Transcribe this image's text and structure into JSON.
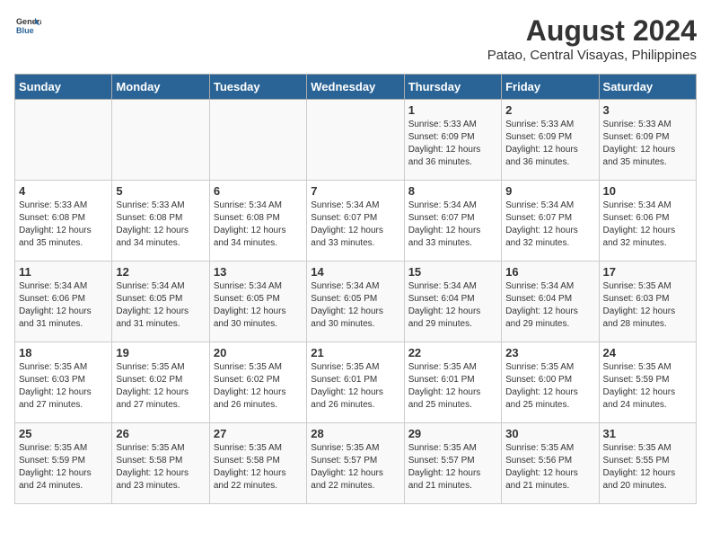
{
  "header": {
    "logo_general": "General",
    "logo_blue": "Blue",
    "title": "August 2024",
    "subtitle": "Patao, Central Visayas, Philippines"
  },
  "days_of_week": [
    "Sunday",
    "Monday",
    "Tuesday",
    "Wednesday",
    "Thursday",
    "Friday",
    "Saturday"
  ],
  "weeks": [
    [
      {
        "day": "",
        "info": ""
      },
      {
        "day": "",
        "info": ""
      },
      {
        "day": "",
        "info": ""
      },
      {
        "day": "",
        "info": ""
      },
      {
        "day": "1",
        "info": "Sunrise: 5:33 AM\nSunset: 6:09 PM\nDaylight: 12 hours\nand 36 minutes."
      },
      {
        "day": "2",
        "info": "Sunrise: 5:33 AM\nSunset: 6:09 PM\nDaylight: 12 hours\nand 36 minutes."
      },
      {
        "day": "3",
        "info": "Sunrise: 5:33 AM\nSunset: 6:09 PM\nDaylight: 12 hours\nand 35 minutes."
      }
    ],
    [
      {
        "day": "4",
        "info": "Sunrise: 5:33 AM\nSunset: 6:08 PM\nDaylight: 12 hours\nand 35 minutes."
      },
      {
        "day": "5",
        "info": "Sunrise: 5:33 AM\nSunset: 6:08 PM\nDaylight: 12 hours\nand 34 minutes."
      },
      {
        "day": "6",
        "info": "Sunrise: 5:34 AM\nSunset: 6:08 PM\nDaylight: 12 hours\nand 34 minutes."
      },
      {
        "day": "7",
        "info": "Sunrise: 5:34 AM\nSunset: 6:07 PM\nDaylight: 12 hours\nand 33 minutes."
      },
      {
        "day": "8",
        "info": "Sunrise: 5:34 AM\nSunset: 6:07 PM\nDaylight: 12 hours\nand 33 minutes."
      },
      {
        "day": "9",
        "info": "Sunrise: 5:34 AM\nSunset: 6:07 PM\nDaylight: 12 hours\nand 32 minutes."
      },
      {
        "day": "10",
        "info": "Sunrise: 5:34 AM\nSunset: 6:06 PM\nDaylight: 12 hours\nand 32 minutes."
      }
    ],
    [
      {
        "day": "11",
        "info": "Sunrise: 5:34 AM\nSunset: 6:06 PM\nDaylight: 12 hours\nand 31 minutes."
      },
      {
        "day": "12",
        "info": "Sunrise: 5:34 AM\nSunset: 6:05 PM\nDaylight: 12 hours\nand 31 minutes."
      },
      {
        "day": "13",
        "info": "Sunrise: 5:34 AM\nSunset: 6:05 PM\nDaylight: 12 hours\nand 30 minutes."
      },
      {
        "day": "14",
        "info": "Sunrise: 5:34 AM\nSunset: 6:05 PM\nDaylight: 12 hours\nand 30 minutes."
      },
      {
        "day": "15",
        "info": "Sunrise: 5:34 AM\nSunset: 6:04 PM\nDaylight: 12 hours\nand 29 minutes."
      },
      {
        "day": "16",
        "info": "Sunrise: 5:34 AM\nSunset: 6:04 PM\nDaylight: 12 hours\nand 29 minutes."
      },
      {
        "day": "17",
        "info": "Sunrise: 5:35 AM\nSunset: 6:03 PM\nDaylight: 12 hours\nand 28 minutes."
      }
    ],
    [
      {
        "day": "18",
        "info": "Sunrise: 5:35 AM\nSunset: 6:03 PM\nDaylight: 12 hours\nand 27 minutes."
      },
      {
        "day": "19",
        "info": "Sunrise: 5:35 AM\nSunset: 6:02 PM\nDaylight: 12 hours\nand 27 minutes."
      },
      {
        "day": "20",
        "info": "Sunrise: 5:35 AM\nSunset: 6:02 PM\nDaylight: 12 hours\nand 26 minutes."
      },
      {
        "day": "21",
        "info": "Sunrise: 5:35 AM\nSunset: 6:01 PM\nDaylight: 12 hours\nand 26 minutes."
      },
      {
        "day": "22",
        "info": "Sunrise: 5:35 AM\nSunset: 6:01 PM\nDaylight: 12 hours\nand 25 minutes."
      },
      {
        "day": "23",
        "info": "Sunrise: 5:35 AM\nSunset: 6:00 PM\nDaylight: 12 hours\nand 25 minutes."
      },
      {
        "day": "24",
        "info": "Sunrise: 5:35 AM\nSunset: 5:59 PM\nDaylight: 12 hours\nand 24 minutes."
      }
    ],
    [
      {
        "day": "25",
        "info": "Sunrise: 5:35 AM\nSunset: 5:59 PM\nDaylight: 12 hours\nand 24 minutes."
      },
      {
        "day": "26",
        "info": "Sunrise: 5:35 AM\nSunset: 5:58 PM\nDaylight: 12 hours\nand 23 minutes."
      },
      {
        "day": "27",
        "info": "Sunrise: 5:35 AM\nSunset: 5:58 PM\nDaylight: 12 hours\nand 22 minutes."
      },
      {
        "day": "28",
        "info": "Sunrise: 5:35 AM\nSunset: 5:57 PM\nDaylight: 12 hours\nand 22 minutes."
      },
      {
        "day": "29",
        "info": "Sunrise: 5:35 AM\nSunset: 5:57 PM\nDaylight: 12 hours\nand 21 minutes."
      },
      {
        "day": "30",
        "info": "Sunrise: 5:35 AM\nSunset: 5:56 PM\nDaylight: 12 hours\nand 21 minutes."
      },
      {
        "day": "31",
        "info": "Sunrise: 5:35 AM\nSunset: 5:55 PM\nDaylight: 12 hours\nand 20 minutes."
      }
    ]
  ]
}
